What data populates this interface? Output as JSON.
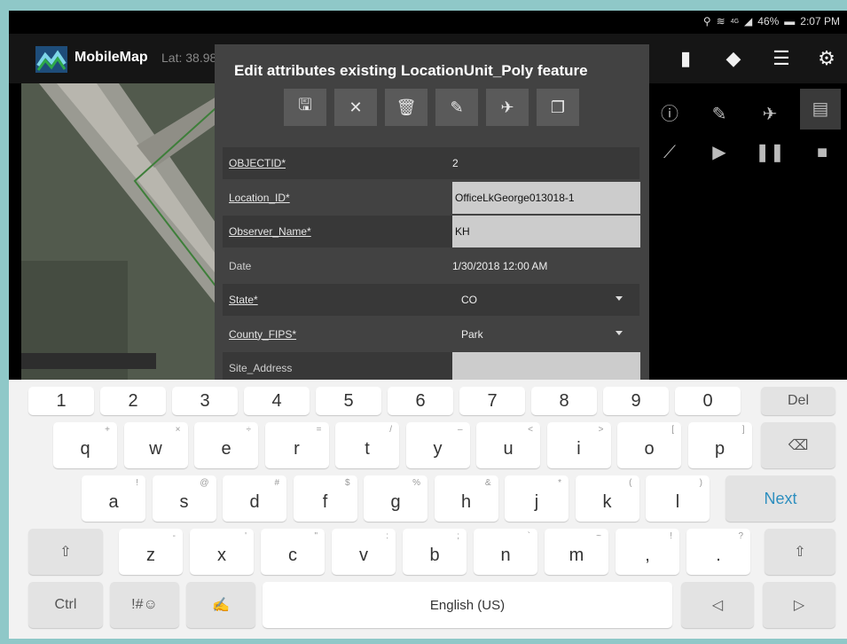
{
  "status": {
    "percent": "46%",
    "time": "2:07 PM",
    "network": "4G"
  },
  "app": {
    "title": "MobileMap",
    "lat": "Lat: 38.98"
  },
  "dialog": {
    "title": "Edit attributes existing LocationUnit_Poly feature",
    "fields": [
      {
        "label": "OBJECTID*",
        "value": "2"
      },
      {
        "label": "Location_ID*",
        "value": "OfficeLkGeorge013018-1"
      },
      {
        "label": "Observer_Name*",
        "value": "KH"
      },
      {
        "label": "Date",
        "value": "1/30/2018 12:00 AM"
      },
      {
        "label": "State*",
        "value": "CO"
      },
      {
        "label": "County_FIPS*",
        "value": "Park"
      },
      {
        "label": "Site_Address",
        "value": ""
      }
    ]
  },
  "keyboard": {
    "numbers": [
      "1",
      "2",
      "3",
      "4",
      "5",
      "6",
      "7",
      "8",
      "9",
      "0"
    ],
    "del": "Del",
    "row1": [
      {
        "k": "q",
        "h": "+"
      },
      {
        "k": "w",
        "h": "×"
      },
      {
        "k": "e",
        "h": "÷"
      },
      {
        "k": "r",
        "h": "="
      },
      {
        "k": "t",
        "h": "/"
      },
      {
        "k": "y",
        "h": "–"
      },
      {
        "k": "u",
        "h": "<"
      },
      {
        "k": "i",
        "h": ">"
      },
      {
        "k": "o",
        "h": "["
      },
      {
        "k": "p",
        "h": "]"
      }
    ],
    "row2": [
      {
        "k": "a",
        "h": "!"
      },
      {
        "k": "s",
        "h": "@"
      },
      {
        "k": "d",
        "h": "#"
      },
      {
        "k": "f",
        "h": "$"
      },
      {
        "k": "g",
        "h": "%"
      },
      {
        "k": "h",
        "h": "&"
      },
      {
        "k": "j",
        "h": "*"
      },
      {
        "k": "k",
        "h": "("
      },
      {
        "k": "l",
        "h": ")"
      }
    ],
    "next": "Next",
    "row3": [
      {
        "k": "z",
        "h": "-"
      },
      {
        "k": "x",
        "h": "'"
      },
      {
        "k": "c",
        "h": "\""
      },
      {
        "k": "v",
        "h": ":"
      },
      {
        "k": "b",
        "h": ";"
      },
      {
        "k": "n",
        "h": "`"
      },
      {
        "k": "m",
        "h": "~"
      },
      {
        "k": ",",
        "h": "!"
      },
      {
        "k": ".",
        "h": "?"
      }
    ],
    "ctrl": "Ctrl",
    "symbols": "!#☺",
    "space": "English (US)"
  }
}
